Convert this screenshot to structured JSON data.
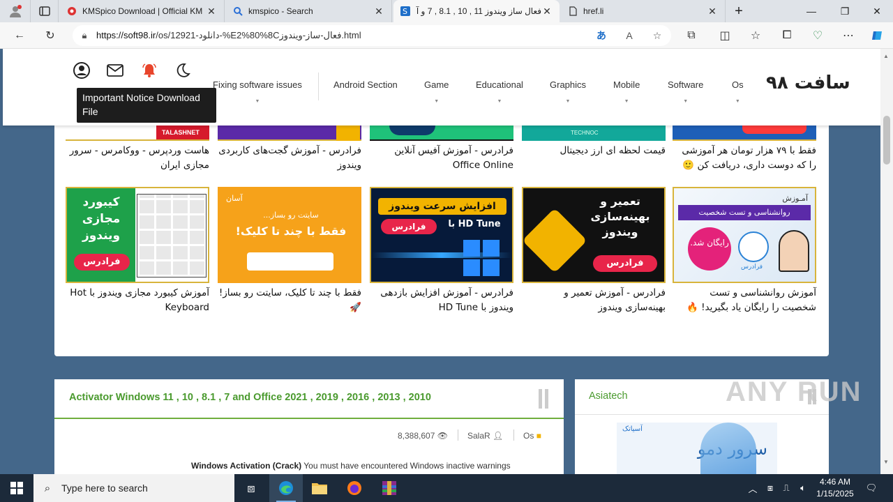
{
  "browser": {
    "tabs": [
      {
        "title": "KMSpico Download | Official KM",
        "active": false
      },
      {
        "title": "kmspico - Search",
        "active": false
      },
      {
        "title": "فعال ساز ویندوز 11 , 10 , 8.1 , 7 و آ",
        "active": true
      },
      {
        "title": "href.li",
        "active": false
      }
    ],
    "new_tab": "+",
    "url_host": "https://soft98.ir",
    "url_path": "/os/12921-دانلود-%E2%80%8Cفعال-ساز-ویندوز.html",
    "window_controls": {
      "minimize": "—",
      "restore": "❐",
      "close": "✕"
    }
  },
  "site": {
    "logo": "سافت ۹۸",
    "nav": [
      "Os",
      "Software",
      "Mobile",
      "Graphics",
      "Educational",
      "Game",
      "Android Section",
      "Fixing software issues"
    ],
    "tooltip": "Important Notice Download File",
    "header_icons": [
      "user-icon",
      "mail-icon",
      "bell-icon",
      "moon-icon"
    ]
  },
  "related": {
    "row1_captions": [
      "فقط با ۷۹ هزار تومان هر آموزشی را که دوست داری، دریافت کن 🙂",
      "قیمت لحظه ای ارز دیجیتال",
      "فرادرس - آموزش آفیس آنلاین Office Online",
      "فرادرس - آموزش گجت‌های کاربردی ویندوز",
      "هاست وردپرس - ووکامرس - سرور مجازی ایران"
    ],
    "row2": [
      {
        "caption": "آموزش روانشناسی و تست شخصیت را رایگان یاد بگیرید! 🔥",
        "img_top": "آمـوزش",
        "img_main": "روانشناسی و تست شخصیت",
        "img_badge": "رایگان شد.",
        "img_brand": "فرادرس"
      },
      {
        "caption": "فرادرس - آموزش تعمیر و بهینه‌سازی ویندوز",
        "img_main": "تعمیر و بهینه‌سازی ویندوز",
        "img_badge": "فرادرس"
      },
      {
        "caption": "فرادرس - آموزش افزایش بازدهی ویندوز با HD Tune",
        "img_main": "افزایش سرعت ویندوز",
        "img_sub": "با HD Tune",
        "img_badge": "فرادرس"
      },
      {
        "caption": "فقط با چند تا کلیک، سایتت رو بساز! 🚀",
        "img_top": "آسان",
        "img_sub": "سایتت رو بساز...",
        "img_main": "فقط با چند تا کلیک!"
      },
      {
        "caption": "آموزش کیبورد مجازی ویندوز با Hot Keyboard",
        "img_main": "کیبورد مجازی ویندوز",
        "img_badge": "فرادرس"
      }
    ],
    "row1_strip_labels": [
      "TALASHNET",
      "TECHNOC"
    ]
  },
  "article": {
    "title": "Activator Windows 11 , 10 , 8.1 , 7 and Office 2021 , 2019 , 2016 , 2013 , 2010",
    "views": "8,388,607",
    "author": "SalaR",
    "category": "Os",
    "excerpt_bold": "Windows Activation (Crack)",
    "excerpt_rest": " You must have encountered Windows inactive warnings"
  },
  "sidebar": {
    "title": "Asiatech",
    "ad_brand": "آسیاتک",
    "ad_text": "سرور دمو"
  },
  "watermark": "ANY RUN",
  "taskbar": {
    "search_placeholder": "Type here to search",
    "time": "4:46 AM",
    "date": "1/15/2025"
  },
  "colors": {
    "accent_green": "#4a9a2e",
    "page_bg": "#44678a",
    "bell": "#e8452c",
    "taskbar": "#1c2a3a"
  }
}
